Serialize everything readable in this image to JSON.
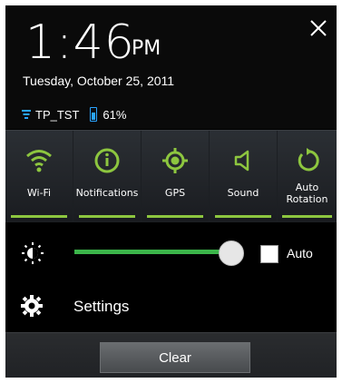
{
  "status": {
    "time": "1:46",
    "ampm": "PM",
    "date": "Tuesday, October 25, 2011",
    "network_name": "TP_TST",
    "battery_percent": "61%"
  },
  "quick_settings": [
    {
      "label": "Wi-Fi",
      "icon": "wifi-icon"
    },
    {
      "label": "Notifications",
      "icon": "info-icon"
    },
    {
      "label": "GPS",
      "icon": "gps-icon"
    },
    {
      "label": "Sound",
      "icon": "speaker-icon"
    },
    {
      "label_line1": "Auto",
      "label_line2": "Rotation",
      "icon": "rotate-icon"
    }
  ],
  "brightness": {
    "auto_label": "Auto",
    "auto_checked": false,
    "level": 0.95
  },
  "settings": {
    "label": "Settings"
  },
  "footer": {
    "clear_label": "Clear"
  },
  "colors": {
    "accent_green": "#8dc63f",
    "slider_green": "#3cb54a",
    "blue": "#2aa4ff"
  }
}
